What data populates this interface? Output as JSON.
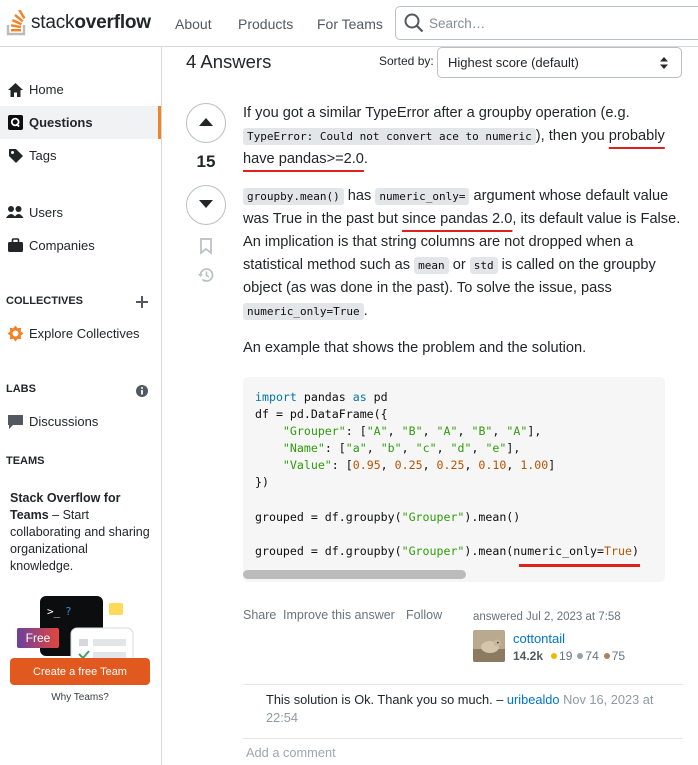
{
  "header": {
    "logo_light": "stack",
    "logo_bold": "overflow",
    "nav": [
      "About",
      "Products",
      "For Teams"
    ],
    "search_placeholder": "Search…"
  },
  "sidebar": {
    "items": [
      {
        "label": "Home",
        "icon": "home-icon"
      },
      {
        "label": "Questions",
        "icon": "questions-icon",
        "active": true
      },
      {
        "label": "Tags",
        "icon": "tag-icon"
      },
      {
        "label": "Users",
        "icon": "users-icon"
      },
      {
        "label": "Companies",
        "icon": "briefcase-icon"
      }
    ],
    "collectives_heading": "COLLECTIVES",
    "explore_collectives": "Explore Collectives",
    "labs_heading": "LABS",
    "discussions": "Discussions",
    "teams_heading": "TEAMS",
    "teams_title": "Stack Overflow for Teams",
    "teams_desc": "– Start collaborating and sharing organizational knowledge.",
    "free_badge": "Free",
    "cta_label": "Create a free Team",
    "why_teams": "Why Teams?"
  },
  "answers": {
    "count_label": "4 Answers",
    "sorted_by_label": "Sorted by:",
    "sort_value": "Highest score (default)"
  },
  "answer": {
    "score": "15",
    "p1_a": "If you got a similar TypeError after a groupby operation (e.g. ",
    "p1_code": "TypeError: Could not convert ace to numeric",
    "p1_b": "), then you ",
    "p1_underlined": "probably have pandas>=2.0",
    "p1_c": ".",
    "p2_code1": "groupby.mean()",
    "p2_a": " has ",
    "p2_code2": "numeric_only=",
    "p2_b": " argument whose default value was True in the past but ",
    "p2_underlined": "since pandas 2.0",
    "p2_c": ", its default value is False. An implication is that string columns are not dropped when a statistical method such as ",
    "p2_code3": "mean",
    "p2_d": " or ",
    "p2_code4": "std",
    "p2_e": " is called on the groupby object (as was done in the past). To solve the issue, pass ",
    "p2_code5": "numeric_only=True",
    "p2_f": ".",
    "p3": "An example that shows the problem and the solution.",
    "code": {
      "kw_import": "import",
      "mod": " pandas ",
      "kw_as": "as",
      "alias": " pd",
      "df_line": "df = pd.DataFrame({",
      "grouper_key": "\"Grouper\"",
      "grouper_vals": [
        "\"A\"",
        "\"B\"",
        "\"A\"",
        "\"B\"",
        "\"A\""
      ],
      "name_key": "\"Name\"",
      "name_vals": [
        "\"a\"",
        "\"b\"",
        "\"c\"",
        "\"d\"",
        "\"e\""
      ],
      "value_key": "\"Value\"",
      "value_vals": [
        "0.95",
        "0.25",
        "0.25",
        "0.10",
        "1.00"
      ],
      "close": "})",
      "g1_a": "grouped = df.groupby(",
      "g_arg": "\"Grouper\"",
      "g1_b": ").mean()",
      "g2_b": ").mean(numeric_only=",
      "g2_true": "True",
      "g2_c": ")"
    },
    "menu": [
      "Share",
      "Improve this answer",
      "Follow"
    ],
    "answered": "answered Jul 2, 2023 at 7:58",
    "user": "cottontail",
    "reputation": "14.2k",
    "gold": "19",
    "silver": "74",
    "bronze": "75"
  },
  "comment": {
    "text": "This solution is Ok. Thank you so much. –",
    "user": "uribealdo",
    "date": "Nov 16, 2023 at 22:54",
    "add_comment": "Add a comment"
  },
  "colors": {
    "accent": "#f48225",
    "cta": "#e1591e",
    "link": "#0074cc",
    "annotation_red": "#e0201c"
  }
}
